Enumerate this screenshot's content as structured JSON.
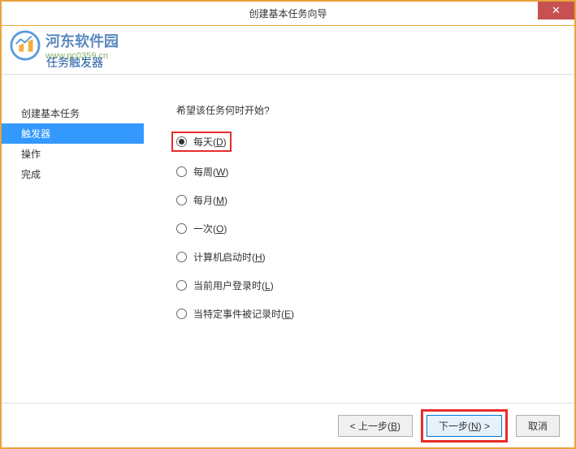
{
  "titlebar": {
    "title": "创建基本任务向导"
  },
  "watermark": {
    "title": "河东软件园",
    "url": "www.pc0359.cn"
  },
  "header": {
    "subtitle": "任务触发器"
  },
  "sidebar": {
    "items": [
      {
        "label": "创建基本任务"
      },
      {
        "label": "触发器"
      },
      {
        "label": "操作"
      },
      {
        "label": "完成"
      }
    ]
  },
  "main": {
    "question": "希望该任务何时开始?",
    "options": [
      {
        "label": "每天(",
        "key": "D",
        "suffix": ")"
      },
      {
        "label": "每周(",
        "key": "W",
        "suffix": ")"
      },
      {
        "label": "每月(",
        "key": "M",
        "suffix": ")"
      },
      {
        "label": "一次(",
        "key": "O",
        "suffix": ")"
      },
      {
        "label": "计算机启动时(",
        "key": "H",
        "suffix": ")"
      },
      {
        "label": "当前用户登录时(",
        "key": "L",
        "suffix": ")"
      },
      {
        "label": "当特定事件被记录时(",
        "key": "E",
        "suffix": ")"
      }
    ]
  },
  "footer": {
    "back": "< 上一步(",
    "back_key": "B",
    "back_suffix": ")",
    "next": "下一步(",
    "next_key": "N",
    "next_suffix": ") >",
    "cancel": "取消"
  }
}
